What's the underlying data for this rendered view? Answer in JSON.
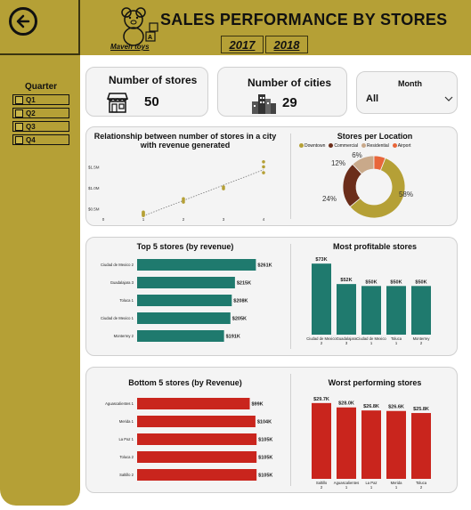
{
  "header": {
    "title": "SALES PERFORMANCE BY STORES",
    "logo_text": "Maven toys",
    "years": [
      "2017",
      "2018"
    ]
  },
  "filters": {
    "quarter_title": "Quarter",
    "quarters": [
      "Q1",
      "Q2",
      "Q3",
      "Q4"
    ],
    "month_label": "Month",
    "month_value": "All"
  },
  "kpis": {
    "stores_label": "Number of stores",
    "stores_value": "50",
    "cities_label": "Number of cities",
    "cities_value": "29"
  },
  "colors": {
    "gold": "#b5a036",
    "teal": "#1f7a6e",
    "red": "#c9251d",
    "donut": [
      "#b5a036",
      "#6b2d1a",
      "#c9a98a",
      "#e8663a"
    ]
  },
  "chart_data": [
    {
      "type": "scatter",
      "title": "Relationship between number of stores in a city with revenue generated",
      "xticks": [
        "0",
        "1",
        "2",
        "3",
        "4"
      ],
      "yticks": [
        "$0.5M",
        "$1.0M",
        "$1.5M"
      ],
      "xlim": [
        0,
        4
      ],
      "ylim": [
        0.3,
        1.7
      ],
      "points": [
        [
          1,
          0.34
        ],
        [
          1,
          0.36
        ],
        [
          1,
          0.38
        ],
        [
          1,
          0.4
        ],
        [
          1,
          0.42
        ],
        [
          2,
          0.66
        ],
        [
          2,
          0.7
        ],
        [
          2,
          0.74
        ],
        [
          3,
          0.98
        ],
        [
          3,
          1.02
        ],
        [
          4,
          1.36
        ],
        [
          4,
          1.5
        ],
        [
          4,
          1.62
        ]
      ],
      "trend": [
        [
          1,
          0.33
        ],
        [
          4,
          1.43
        ]
      ]
    },
    {
      "type": "pie",
      "title": "Stores per Location",
      "labels": [
        "Downtown",
        "Commercial",
        "Residential",
        "Airport"
      ],
      "values": [
        58,
        24,
        12,
        6
      ],
      "value_labels": [
        "58%",
        "24%",
        "12%",
        "6%"
      ]
    },
    {
      "type": "bar",
      "title": "Top 5 stores (by revenue)",
      "orientation": "horizontal",
      "categories": [
        "Ciudad de Mexico 2",
        "Guadalajara 3",
        "Toluca 1",
        "Ciudad de Mexico 1",
        "Monterrey 2"
      ],
      "values": [
        261,
        215,
        208,
        205,
        191
      ],
      "labels": [
        "$261K",
        "$215K",
        "$208K",
        "$205K",
        "$191K"
      ],
      "xlim": [
        0,
        270
      ]
    },
    {
      "type": "bar",
      "title": "Most profitable stores",
      "orientation": "vertical",
      "categories": [
        "Ciudad de Mexico 2",
        "Guadalajara 3",
        "Ciudad de Mexico 1",
        "Toluca 1",
        "Monterrey 2"
      ],
      "values": [
        73,
        52,
        50,
        50,
        50
      ],
      "labels": [
        "$73K",
        "$52K",
        "$50K",
        "$50K",
        "$50K"
      ],
      "ylim": [
        0,
        75
      ]
    },
    {
      "type": "bar",
      "title": "Bottom 5 stores (by Revenue)",
      "orientation": "horizontal",
      "categories": [
        "Aguascalientes 1",
        "Merida 1",
        "La Paz 1",
        "Toluca 2",
        "Saltillo 2"
      ],
      "values": [
        99,
        104,
        105,
        105,
        105
      ],
      "labels": [
        "$99K",
        "$104K",
        "$105K",
        "$105K",
        "$105K"
      ],
      "xlim": [
        0,
        108
      ]
    },
    {
      "type": "bar",
      "title": "Worst performing stores",
      "orientation": "vertical",
      "categories": [
        "Saltillo 2",
        "Aguascalientes 1",
        "La Paz 1",
        "Merida 1",
        "Toluca 2"
      ],
      "values": [
        29.7,
        28.0,
        26.8,
        26.6,
        25.8
      ],
      "labels": [
        "$29.7K",
        "$28.0K",
        "$26.8K",
        "$26.6K",
        "$25.8K"
      ],
      "ylim": [
        0,
        30
      ]
    }
  ]
}
